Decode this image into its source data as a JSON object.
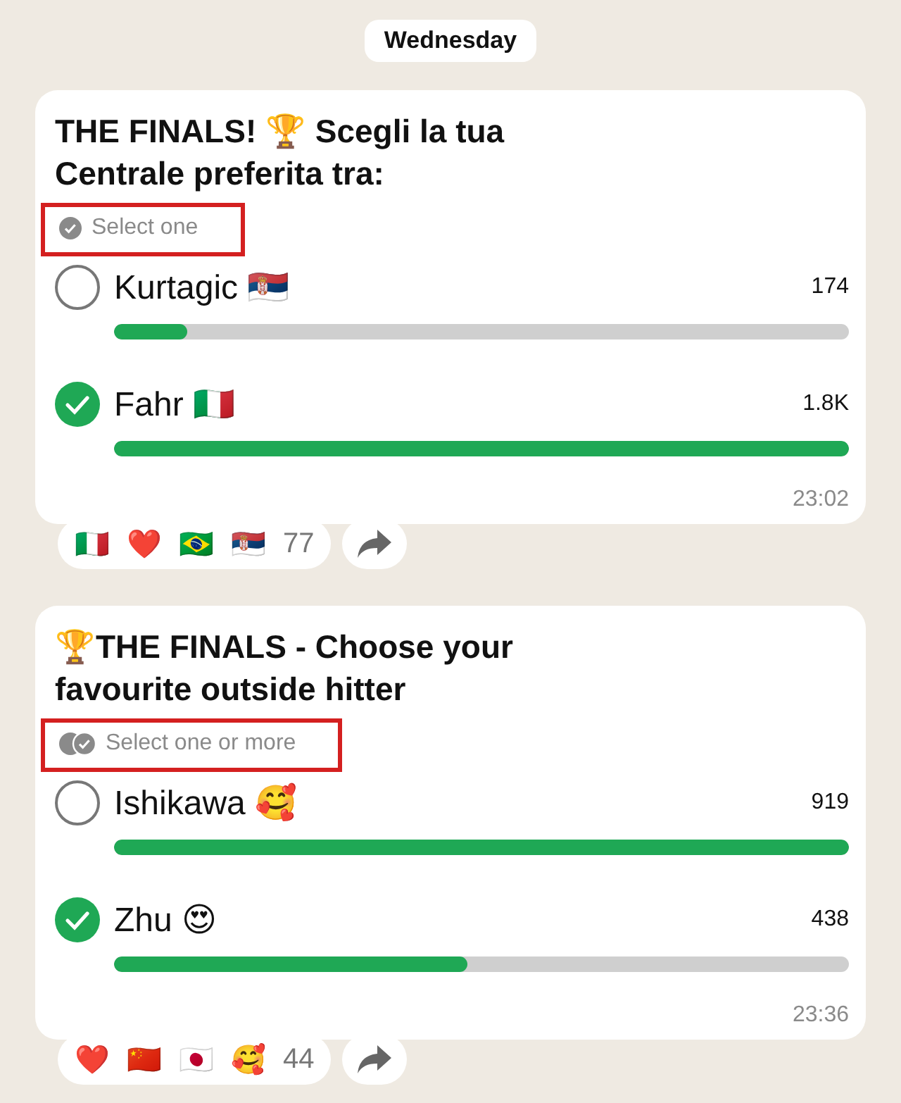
{
  "date_chip": "Wednesday",
  "polls": [
    {
      "title": "THE FINALS! 🏆 Scegli la tua Centrale preferita tra:",
      "mode": {
        "kind": "single",
        "text": "Select one",
        "highlighted": true
      },
      "options": [
        {
          "label": "Kurtagic 🇷🇸",
          "count": "174",
          "level": 0.1,
          "selected": false
        },
        {
          "label": "Fahr 🇮🇹",
          "count": "1.8K",
          "level": 1,
          "selected": true
        }
      ],
      "time": "23:02",
      "reactions": [
        "🇮🇹",
        "❤️",
        "🇧🇷",
        "🇷🇸"
      ],
      "reaction_count": "77"
    },
    {
      "title": "🏆THE FINALS - Choose your favourite outside hitter",
      "mode": {
        "kind": "multiple",
        "text": "Select one or more",
        "highlighted": true
      },
      "options": [
        {
          "label": "Ishikawa 🥰",
          "count": "919",
          "level": 1,
          "selected": false
        },
        {
          "label": "Zhu 😍",
          "count": "438",
          "level": 0.48,
          "selected": true
        }
      ],
      "time": "23:36",
      "reactions": [
        "❤️",
        "🇨🇳",
        "🇯🇵",
        "🥰"
      ],
      "reaction_count": "44"
    }
  ]
}
